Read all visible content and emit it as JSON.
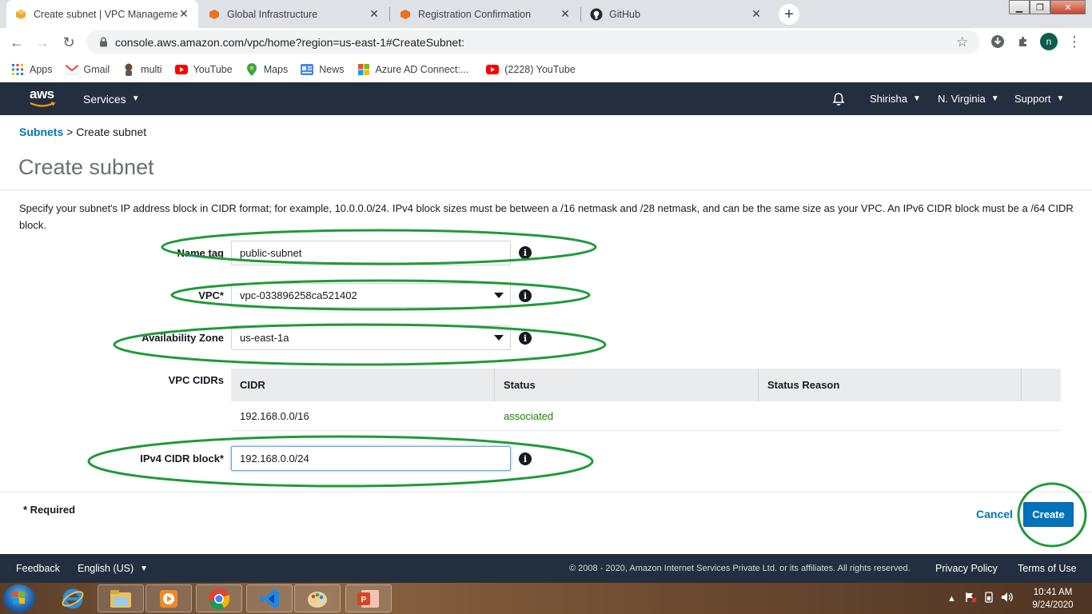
{
  "browser": {
    "tabs": [
      {
        "title": "Create subnet | VPC Management",
        "favicon": "aws-cube-icon",
        "active": true
      },
      {
        "title": "Global Infrastructure",
        "favicon": "aws-orange-icon",
        "active": false
      },
      {
        "title": "Registration Confirmation",
        "favicon": "aws-orange-icon",
        "active": false
      },
      {
        "title": "GitHub",
        "favicon": "github-icon",
        "active": false
      }
    ],
    "url": "console.aws.amazon.com/vpc/home?region=us-east-1#CreateSubnet:",
    "profile_initial": "n",
    "bookmarks": [
      {
        "label": "Apps",
        "icon": "apps-grid-icon"
      },
      {
        "label": "Gmail",
        "icon": "gmail-icon"
      },
      {
        "label": "multi",
        "icon": "multi-icon"
      },
      {
        "label": "YouTube",
        "icon": "youtube-icon"
      },
      {
        "label": "Maps",
        "icon": "maps-icon"
      },
      {
        "label": "News",
        "icon": "news-icon"
      },
      {
        "label": "Azure AD Connect:...",
        "icon": "microsoft-icon"
      },
      {
        "label": "(2228) YouTube",
        "icon": "youtube-icon"
      }
    ]
  },
  "aws_header": {
    "logo_text": "aws",
    "services": "Services",
    "user": "Shirisha",
    "region": "N. Virginia",
    "support": "Support"
  },
  "breadcrumb": {
    "parent": "Subnets",
    "separator": " > ",
    "current": "Create subnet"
  },
  "page_title": "Create subnet",
  "description": "Specify your subnet's IP address block in CIDR format; for example, 10.0.0.0/24. IPv4 block sizes must be between a /16 netmask and /28 netmask, and can be the same size as your VPC. An IPv6 CIDR block must be a /64 CIDR block.",
  "form": {
    "name_tag": {
      "label": "Name tag",
      "value": "public-subnet"
    },
    "vpc": {
      "label": "VPC*",
      "value": "vpc-033896258ca521402"
    },
    "availability_zone": {
      "label": "Availability Zone",
      "value": "us-east-1a"
    },
    "vpc_cidrs": {
      "label": "VPC CIDRs",
      "columns": [
        "CIDR",
        "Status",
        "Status Reason"
      ],
      "rows": [
        {
          "cidr": "192.168.0.0/16",
          "status": "associated",
          "reason": ""
        }
      ]
    },
    "ipv4_cidr": {
      "label": "IPv4 CIDR block*",
      "value": "192.168.0.0/24"
    },
    "info_glyph": "i",
    "required_note": "* Required",
    "cancel_label": "Cancel",
    "create_label": "Create"
  },
  "colors": {
    "aws_nav_bg": "#232f3e",
    "link_blue": "#0073bb",
    "status_green": "#1d8102",
    "annotation_green": "#1f9a3a"
  },
  "aws_footer": {
    "feedback": "Feedback",
    "language": "English (US)",
    "copyright": "© 2008 - 2020, Amazon Internet Services Private Ltd. or its affiliates. All rights reserved.",
    "privacy": "Privacy Policy",
    "terms": "Terms of Use"
  },
  "taskbar": {
    "apps": [
      "internet-explorer-icon",
      "file-explorer-icon",
      "media-player-icon",
      "chrome-icon",
      "vscode-icon",
      "paint-icon",
      "powerpoint-icon"
    ],
    "time": "10:41 AM",
    "date": "9/24/2020"
  }
}
